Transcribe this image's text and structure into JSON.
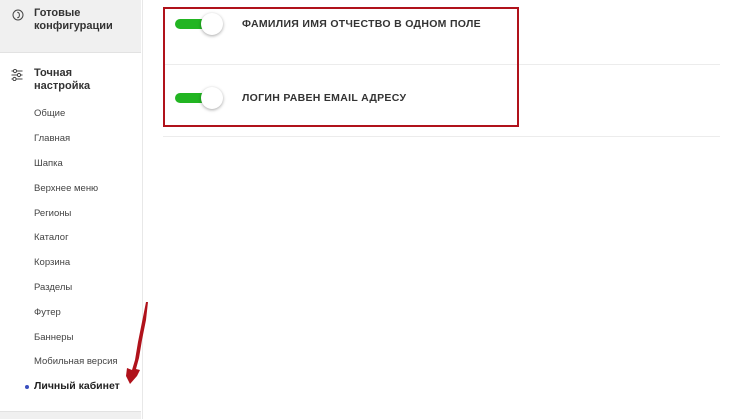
{
  "sidebar": {
    "ready_configs": {
      "icon": "circle-info-icon",
      "label_line1": "Готовые",
      "label_line2": "конфигурации"
    },
    "fine_tuning": {
      "icon": "sliders-icon",
      "label_line1": "Точная",
      "label_line2": "настройка",
      "items": [
        {
          "label": "Общие"
        },
        {
          "label": "Главная"
        },
        {
          "label": "Шапка"
        },
        {
          "label": "Верхнее меню"
        },
        {
          "label": "Регионы"
        },
        {
          "label": "Каталог"
        },
        {
          "label": "Корзина"
        },
        {
          "label": "Разделы"
        },
        {
          "label": "Футер"
        },
        {
          "label": "Баннеры"
        },
        {
          "label": "Мобильная версия"
        },
        {
          "label": "Личный кабинет",
          "active": true
        }
      ]
    }
  },
  "settings": [
    {
      "label": "ФАМИЛИЯ ИМЯ ОТЧЕСТВО В ОДНОМ ПОЛЕ",
      "enabled": true
    },
    {
      "label": "ЛОГИН РАВЕН EMAIL АДРЕСУ",
      "enabled": true
    }
  ],
  "colors": {
    "toggle_on": "#22b522",
    "highlight": "#b0121b",
    "active_dot": "#3a4fbf",
    "arrow": "#b0121b"
  }
}
